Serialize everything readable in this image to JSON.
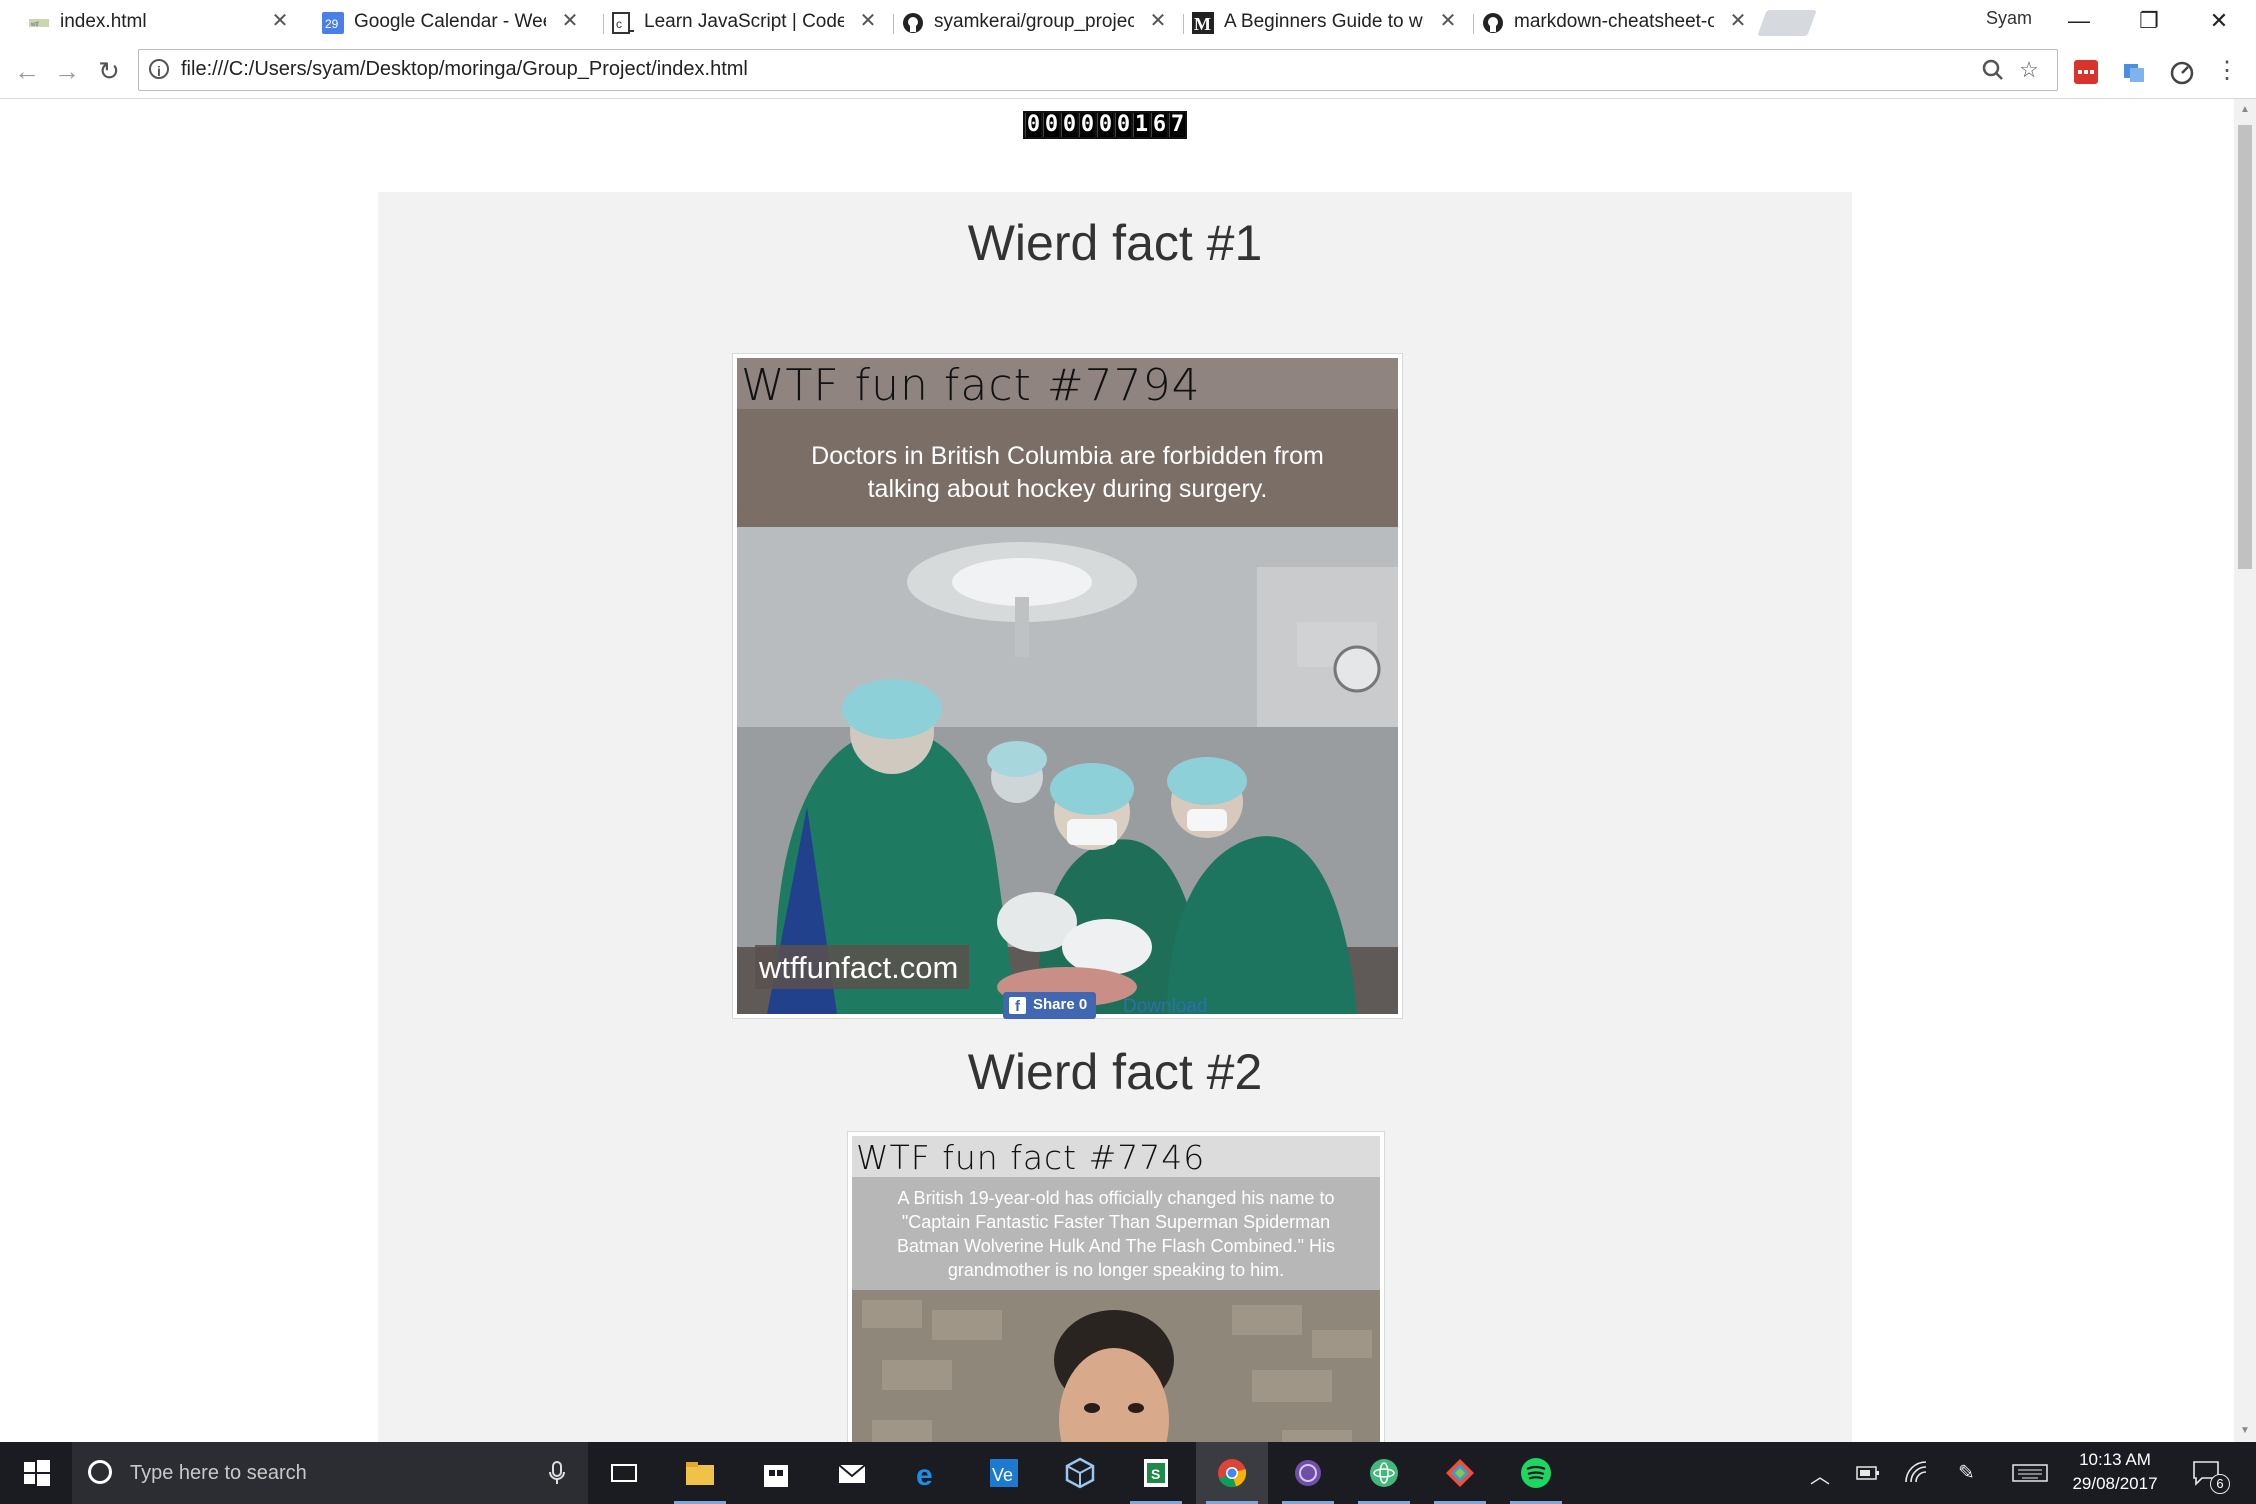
{
  "browser": {
    "tabs": [
      {
        "title": "index.html",
        "active": true
      },
      {
        "title": "Google Calendar - Week",
        "favicon_text": "29"
      },
      {
        "title": "Learn JavaScript | Codeca",
        "favicon_text": "c"
      },
      {
        "title": "syamkerai/group_project"
      },
      {
        "title": "A Beginners Guide to wri",
        "favicon_text": "M"
      },
      {
        "title": "markdown-cheatsheet-o"
      }
    ],
    "profile_name": "Syam",
    "address_url": "file:///C:/Users/syam/Desktop/moringa/Group_Project/index.html"
  },
  "page": {
    "visitor_counter": [
      "0",
      "0",
      "0",
      "0",
      "0",
      "0",
      "1",
      "6",
      "7"
    ],
    "facts": [
      {
        "heading": "Wierd fact #1",
        "banner_title": "WTF fun fact #7794",
        "fact_text_line1": "Doctors in British Columbia are forbidden from",
        "fact_text_line2": "talking about hockey during surgery.",
        "watermark": "wtffunfact.com"
      },
      {
        "heading": "Wierd fact #2",
        "banner_title": "WTF fun fact #7746",
        "fact_text_line1": "A British 19-year-old has officially changed his name to",
        "fact_text_line2": "\"Captain Fantastic Faster Than Superman Spiderman",
        "fact_text_line3": "Batman Wolverine Hulk And The Flash Combined.\" His",
        "fact_text_line4": "grandmother is no longer speaking to him."
      }
    ],
    "share_label": "Share 0",
    "download_label": "Download"
  },
  "taskbar": {
    "search_placeholder": "Type here to search",
    "time": "10:13 AM",
    "date": "29/08/2017",
    "notification_count": "6"
  },
  "colors": {
    "banner1": "#7b6e67",
    "banner1_title": "#8f8480",
    "banner2": "#b7b7b7",
    "banner2_title": "#dcdcdc",
    "scrub_green": "#1f7a62",
    "facebook_blue": "#4267b2"
  }
}
